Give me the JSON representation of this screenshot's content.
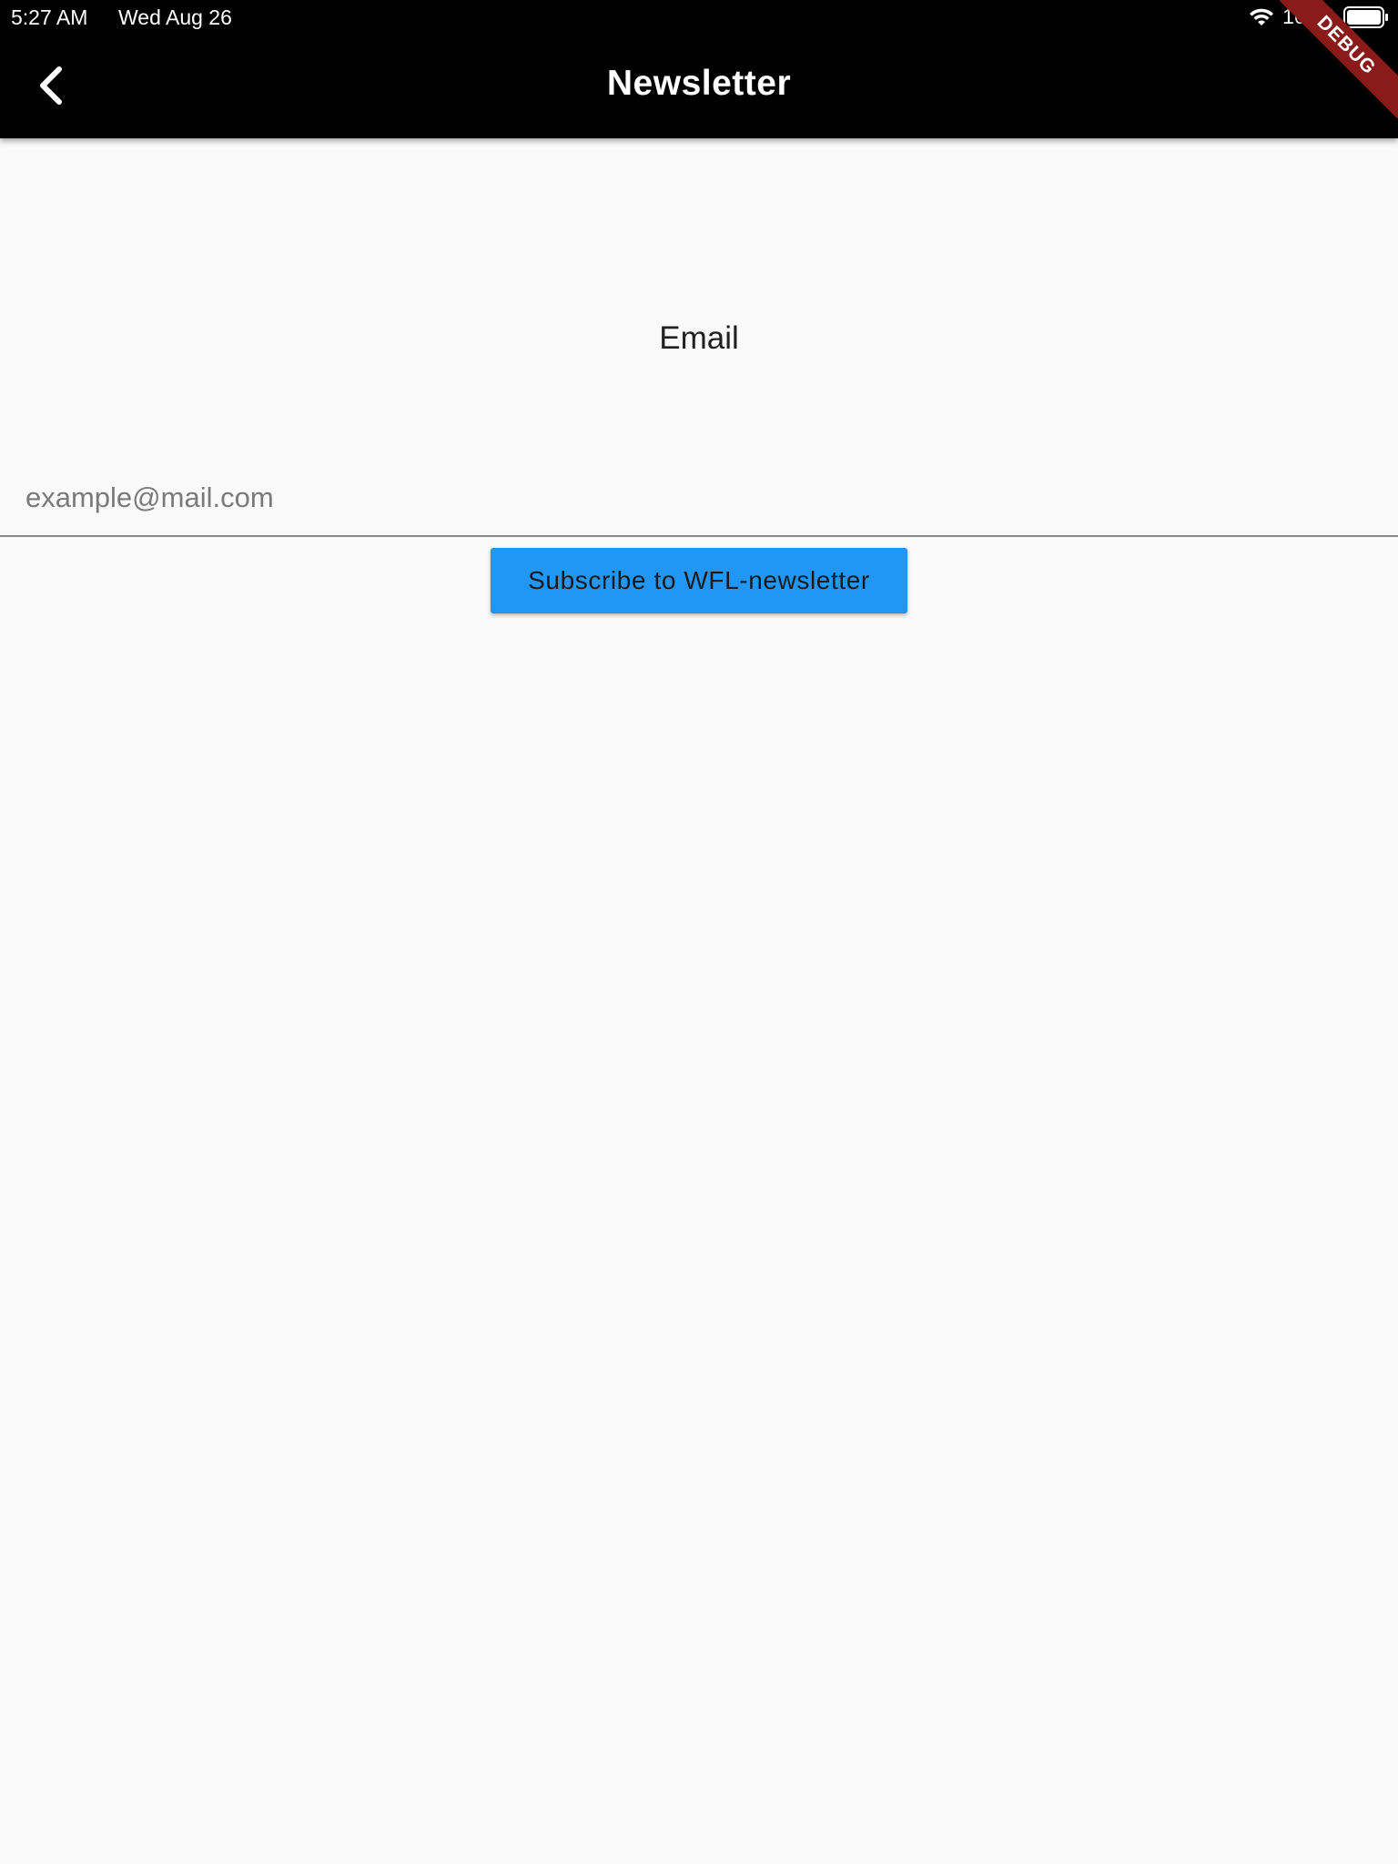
{
  "status_bar": {
    "time": "5:27 AM",
    "date": "Wed Aug 26",
    "battery_percent": "100%",
    "icons": [
      "wifi-icon",
      "battery-icon"
    ]
  },
  "app_bar": {
    "title": "Newsletter",
    "back_icon": "chevron-left-icon"
  },
  "debug_banner": {
    "label": "DEBUG"
  },
  "form": {
    "email_label": "Email",
    "email_value": "",
    "email_placeholder": "example@mail.com",
    "subscribe_label": "Subscribe to WFL-newsletter"
  },
  "colors": {
    "app_bar": "#000000",
    "background": "#fafafa",
    "button": "#2196f3",
    "debug_ribbon": "#8b1a1a"
  }
}
